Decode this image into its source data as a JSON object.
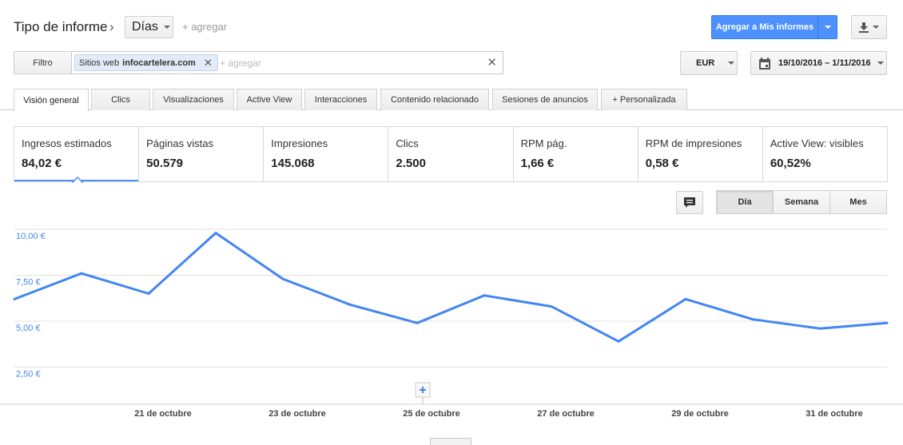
{
  "header": {
    "title": "Tipo de informe",
    "dimension": "Días",
    "add_label": "+ agregar",
    "add_to_reports": "Agregar a Mis informes"
  },
  "filter": {
    "label": "Filtro",
    "chip_key": "Sitios web",
    "chip_value": "infocartelera.com",
    "placeholder": "+ agregar"
  },
  "currency": "EUR",
  "date_range": "19/10/2016 – 1/11/2016",
  "tabs": [
    {
      "label": "Visión general",
      "active": true
    },
    {
      "label": "Clics"
    },
    {
      "label": "Visualizaciones"
    },
    {
      "label": "Active View"
    },
    {
      "label": "Interacciones"
    },
    {
      "label": "Contenido relacionado"
    },
    {
      "label": "Sesiones de anuncios"
    },
    {
      "label": "+ Personalizada"
    }
  ],
  "metrics": [
    {
      "name": "Ingresos estimados",
      "value": "84,02 €",
      "selected": true
    },
    {
      "name": "Páginas vistas",
      "value": "50.579"
    },
    {
      "name": "Impresiones",
      "value": "145.068"
    },
    {
      "name": "Clics",
      "value": "2.500"
    },
    {
      "name": "RPM pág.",
      "value": "1,66 €"
    },
    {
      "name": "RPM de impresiones",
      "value": "0,58 €"
    },
    {
      "name": "Active View: visibles",
      "value": "60,52%"
    }
  ],
  "granularity": {
    "day": "Día",
    "week": "Semana",
    "month": "Mes",
    "selected": "Día"
  },
  "colors": {
    "accent": "#4d90fe",
    "line": "#4285f4",
    "axis_text": "#4285f4"
  },
  "chart_data": {
    "type": "line",
    "x": [
      "19 oct",
      "20 oct",
      "21 oct",
      "22 oct",
      "23 oct",
      "24 oct",
      "25 oct",
      "26 oct",
      "27 oct",
      "28 oct",
      "29 oct",
      "30 oct",
      "31 oct",
      "1 nov"
    ],
    "series": [
      {
        "values": [
          6.2,
          7.6,
          6.5,
          9.8,
          7.3,
          5.9,
          4.9,
          6.4,
          5.8,
          3.9,
          6.2,
          5.1,
          4.6,
          4.9
        ]
      }
    ],
    "y_tick_labels": [
      "10,00 €",
      "7,50 €",
      "5,00 €",
      "2,50 €"
    ],
    "y_ticks": [
      10,
      7.5,
      5,
      2.5
    ],
    "x_tick_labels": [
      "21 de octubre",
      "23 de octubre",
      "25 de octubre",
      "27 de octubre",
      "29 de octubre",
      "31 de octubre"
    ],
    "ylim": [
      0,
      11
    ],
    "grid": true
  }
}
